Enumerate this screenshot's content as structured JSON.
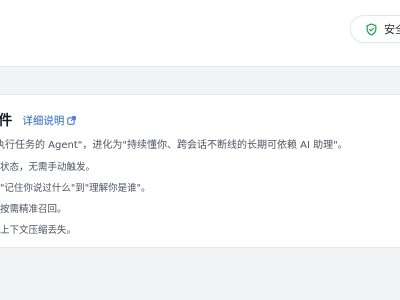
{
  "header": {
    "security_label": "安全"
  },
  "plugin": {
    "title": "插件",
    "detail_link": "详细说明",
    "description": "执行任务的 Agent\"，进化为\"持续懂你、跨会话不断线的长期可依赖 AI 助理\"。",
    "features": [
      "状态，无需手动触发。",
      "\"记住你说过什么\"到\"理解你是谁\"。",
      "按需精准召回。",
      "上下文压缩丢失。"
    ]
  },
  "colors": {
    "accent": "#2563eb",
    "security_icon": "#16a34a",
    "page_background": "#f3f4f6",
    "card_background": "#ffffff"
  },
  "icons": {
    "security": "shield-check-icon",
    "detail_link": "external-link-icon"
  }
}
